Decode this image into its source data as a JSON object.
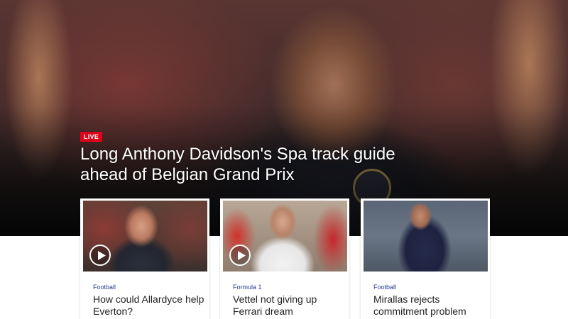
{
  "hero": {
    "badge": "LIVE",
    "headline": "Long Anthony Davidson's Spa track guide ahead of Belgian Grand Prix"
  },
  "cards": [
    {
      "category": "Football",
      "title": "How could Allardyce help Everton?",
      "has_video": true
    },
    {
      "category": "Formula 1",
      "title": "Vettel not giving up Ferrari dream",
      "has_video": true
    },
    {
      "category": "Football",
      "title": "Mirallas rejects commitment problem",
      "has_video": false
    }
  ],
  "icons": {
    "play": "play-icon"
  },
  "colors": {
    "live_badge": "#e1001a",
    "category": "#2a3a8f"
  }
}
